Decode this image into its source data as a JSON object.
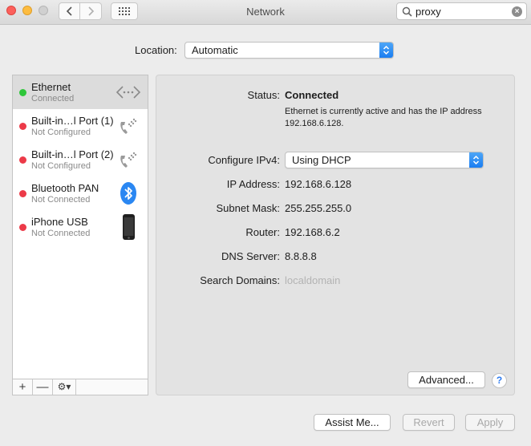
{
  "window": {
    "title": "Network"
  },
  "search": {
    "value": "proxy"
  },
  "location": {
    "label": "Location:",
    "value": "Automatic"
  },
  "services": [
    {
      "name": "Ethernet",
      "status": "Connected",
      "status_color": "#2ec63a",
      "icon": "ethernet-icon",
      "selected": true
    },
    {
      "name": "Built-in…l Port (1)",
      "status": "Not Configured",
      "status_color": "#ec3a48",
      "icon": "phone-modem-icon"
    },
    {
      "name": "Built-in…l Port (2)",
      "status": "Not Configured",
      "status_color": "#ec3a48",
      "icon": "phone-modem-icon"
    },
    {
      "name": "Bluetooth PAN",
      "status": "Not Connected",
      "status_color": "#ec3a48",
      "icon": "bluetooth-icon"
    },
    {
      "name": "iPhone USB",
      "status": "Not Connected",
      "status_color": "#ec3a48",
      "icon": "iphone-icon"
    }
  ],
  "list_toolbar": {
    "add": "+",
    "remove": "—",
    "gear": "⚙▾"
  },
  "detail": {
    "status_label": "Status:",
    "status_value": "Connected",
    "status_desc": "Ethernet is currently active and has the IP address 192.168.6.128.",
    "configure_label": "Configure IPv4:",
    "configure_value": "Using DHCP",
    "ip_label": "IP Address:",
    "ip_value": "192.168.6.128",
    "subnet_label": "Subnet Mask:",
    "subnet_value": "255.255.255.0",
    "router_label": "Router:",
    "router_value": "192.168.6.2",
    "dns_label": "DNS Server:",
    "dns_value": "8.8.8.8",
    "search_domains_label": "Search Domains:",
    "search_domains_value": "localdomain",
    "advanced_button": "Advanced...",
    "help_button": "?"
  },
  "footer": {
    "assist": "Assist Me...",
    "revert": "Revert",
    "apply": "Apply"
  },
  "colors": {
    "accent": "#1a7df1",
    "connected": "#2ec63a",
    "disconnected": "#ec3a48"
  }
}
